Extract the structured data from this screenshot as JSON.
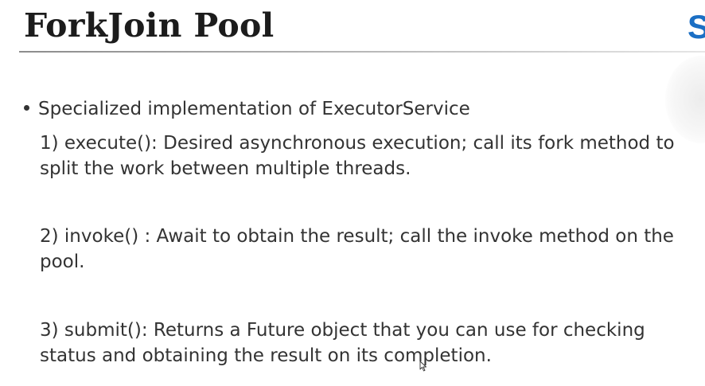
{
  "slide": {
    "title": "ForkJoin Pool",
    "logo_fragment": "S",
    "bullet": "Specialized implementation of ExecutorService",
    "items": [
      {
        "line1": "1) execute(): Desired asynchronous execution; call its fork method to",
        "line2": "split the work between multiple threads."
      },
      {
        "line1": "2) invoke() : Await to obtain the result; call the invoke method on the",
        "line2": "pool."
      },
      {
        "line1": "3) submit(): Returns a Future object that you can use for checking",
        "line2": "status and obtaining the result on its completion."
      }
    ]
  },
  "cursor_icon": "mouse-pointer-icon",
  "colors": {
    "title_text": "#1c1c1c",
    "body_text": "#333333",
    "logo_accent": "#1b6fc4"
  }
}
